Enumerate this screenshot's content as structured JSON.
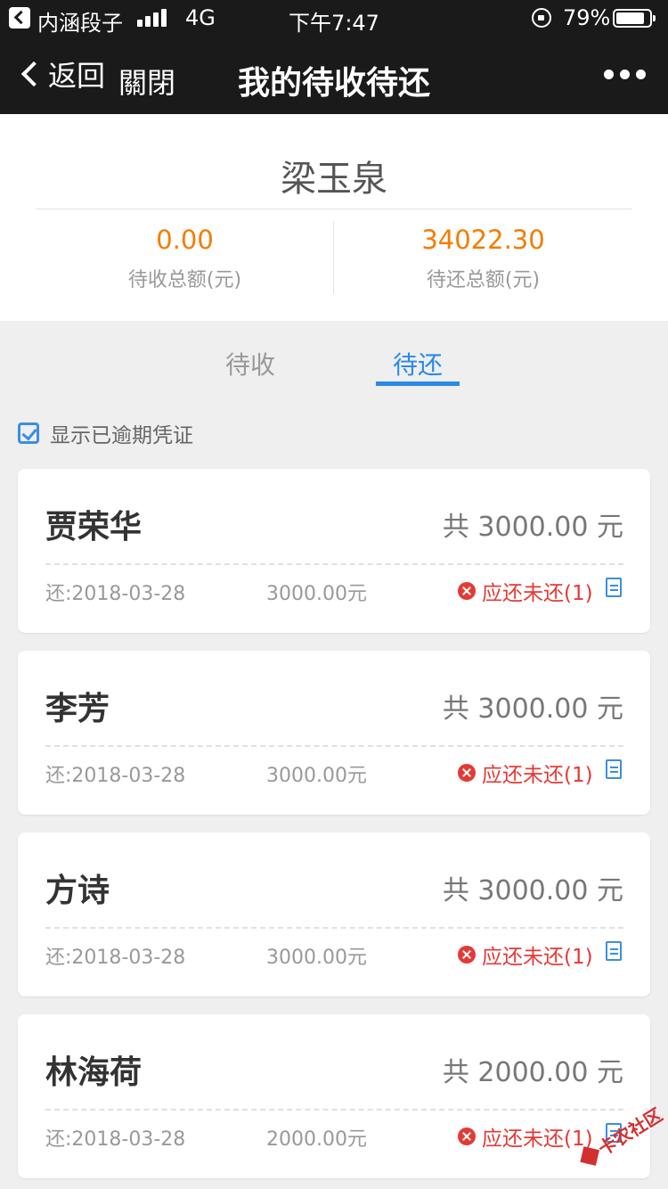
{
  "status_bar": {
    "carrier": "内涵段子",
    "network": "4G",
    "time": "下午7:47",
    "battery_percent": "79%",
    "battery_level": 0.79
  },
  "nav": {
    "back_label": "返回",
    "close_label": "關閉",
    "title": "我的待收待还"
  },
  "summary": {
    "name": "梁玉泉",
    "receivable": {
      "amount": "0.00",
      "label": "待收总额(元)"
    },
    "payable": {
      "amount": "34022.30",
      "label": "待还总额(元)"
    }
  },
  "tabs": [
    {
      "label": "待收",
      "active": false
    },
    {
      "label": "待还",
      "active": true
    }
  ],
  "filter": {
    "show_overdue_label": "显示已逾期凭证",
    "checked": true
  },
  "records": [
    {
      "name": "贾荣华",
      "total": "共 3000.00 元",
      "due": "还:2018-03-28",
      "amount": "3000.00元",
      "status": "应还未还(1)"
    },
    {
      "name": "李芳",
      "total": "共 3000.00 元",
      "due": "还:2018-03-28",
      "amount": "3000.00元",
      "status": "应还未还(1)"
    },
    {
      "name": "方诗",
      "total": "共 3000.00 元",
      "due": "还:2018-03-28",
      "amount": "3000.00元",
      "status": "应还未还(1)"
    },
    {
      "name": "林海荷",
      "total": "共 2000.00 元",
      "due": "还:2018-03-28",
      "amount": "2000.00元",
      "status": "应还未还(1)"
    }
  ],
  "watermark": "卡农社区",
  "colors": {
    "header_bg": "#1a1a1a",
    "accent_blue": "#2b8ae6",
    "amount_orange": "#f57c00",
    "overdue_red": "#e53935"
  }
}
